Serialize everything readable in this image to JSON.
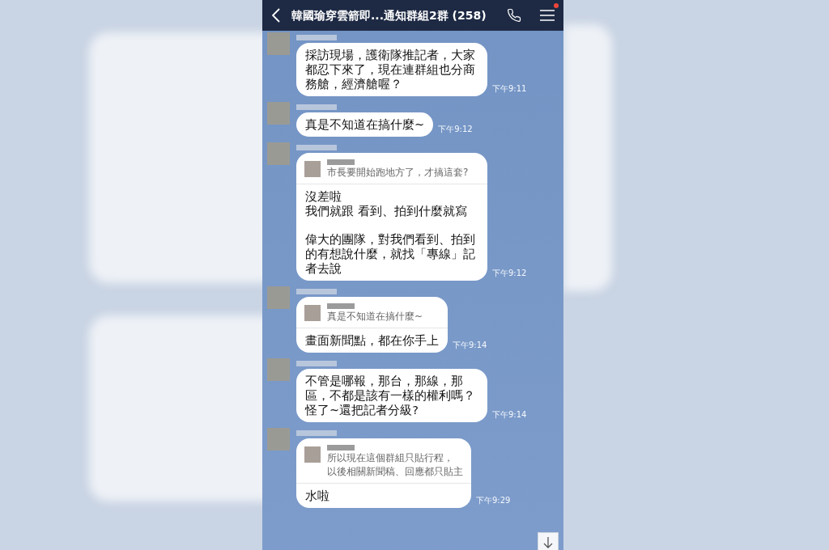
{
  "header": {
    "title": "韓國瑜穿雲箭即...通知群組2群 (258)",
    "menu_badge": true
  },
  "messages": [
    {
      "kind": "plain",
      "paragraphs": [
        [
          "採訪現場，護衛隊推記者，大家都忍下來了，現在連群組也分商務艙，經濟艙喔？"
        ]
      ],
      "time": "下午9:11"
    },
    {
      "kind": "plain",
      "paragraphs": [
        [
          "真是不知道在搞什麼~"
        ]
      ],
      "time": "下午9:12"
    },
    {
      "kind": "reply",
      "quote_lines": [
        "市長要開始跑地方了，才搞這套?"
      ],
      "paragraphs": [
        [
          "沒差啦",
          "我們就跟 看到、拍到什麼就寫"
        ],
        [
          "偉大的團隊，對我們看到、拍到的有想說什麼，就找「專線」記者去說"
        ]
      ],
      "time": "下午9:12"
    },
    {
      "kind": "reply",
      "quote_lines": [
        "真是不知道在搞什麼~"
      ],
      "paragraphs": [
        [
          "畫面新聞點，都在你手上"
        ]
      ],
      "time": "下午9:14"
    },
    {
      "kind": "plain",
      "paragraphs": [
        [
          "不管是哪報，那台，那線，那區，不都是該有一樣的權利嗎？怪了~還把記者分級?"
        ]
      ],
      "time": "下午9:14"
    },
    {
      "kind": "reply",
      "quote_lines": [
        "所以現在這個群組只貼行程，",
        "以後相關新聞稿、回應都只貼主"
      ],
      "paragraphs": [
        [
          "水啦"
        ]
      ],
      "time": "下午9:29"
    }
  ]
}
